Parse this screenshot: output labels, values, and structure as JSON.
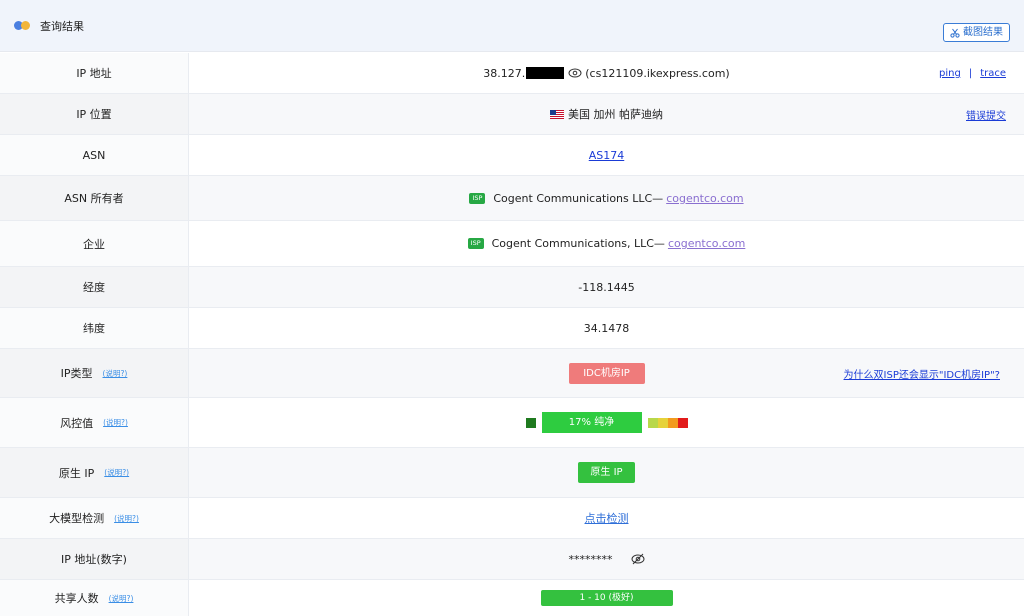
{
  "header": {
    "title": "查询结果",
    "screenshot_label": "截图结果"
  },
  "rows": {
    "ip": {
      "label": "IP 地址",
      "ip_prefix": "38.127.",
      "host": "(cs121109.ikexpress.com)",
      "ping": "ping",
      "sep": "|",
      "trace": "trace"
    },
    "location": {
      "label": "IP 位置",
      "value": "美国 加州 帕萨迪纳",
      "report": "错误提交"
    },
    "asn": {
      "label": "ASN",
      "value": "AS174"
    },
    "asn_owner": {
      "label": "ASN 所有者",
      "tag": "ISP",
      "name": "Cogent Communications LLC—",
      "domain": "cogentco.com"
    },
    "company": {
      "label": "企业",
      "tag": "ISP",
      "name": "Cogent Communications, LLC—",
      "domain": "cogentco.com"
    },
    "longitude": {
      "label": "经度",
      "value": "-118.1445"
    },
    "latitude": {
      "label": "纬度",
      "value": "34.1478"
    },
    "ip_type": {
      "label": "IP类型",
      "help": "(说明?)",
      "value": "IDC机房IP",
      "why": "为什么双ISP还会显示\"IDC机房IP\"?"
    },
    "risk": {
      "label": "风控值",
      "help": "(说明?)",
      "value": "17% 纯净",
      "percent": 17
    },
    "native": {
      "label": "原生 IP",
      "help": "(说明?)",
      "value": "原生 IP"
    },
    "llm": {
      "label": "大模型检测",
      "help": "(说明?)",
      "value": "点击检测"
    },
    "ip_number": {
      "label": "IP 地址(数字)",
      "value": "********"
    },
    "shared": {
      "label": "共享人数",
      "help": "(说明?)",
      "value": "1 - 10 (极好)"
    }
  },
  "colors": {
    "accent": "#1a3bd6",
    "good": "#34c13f",
    "warn": "#ef7b7b"
  }
}
